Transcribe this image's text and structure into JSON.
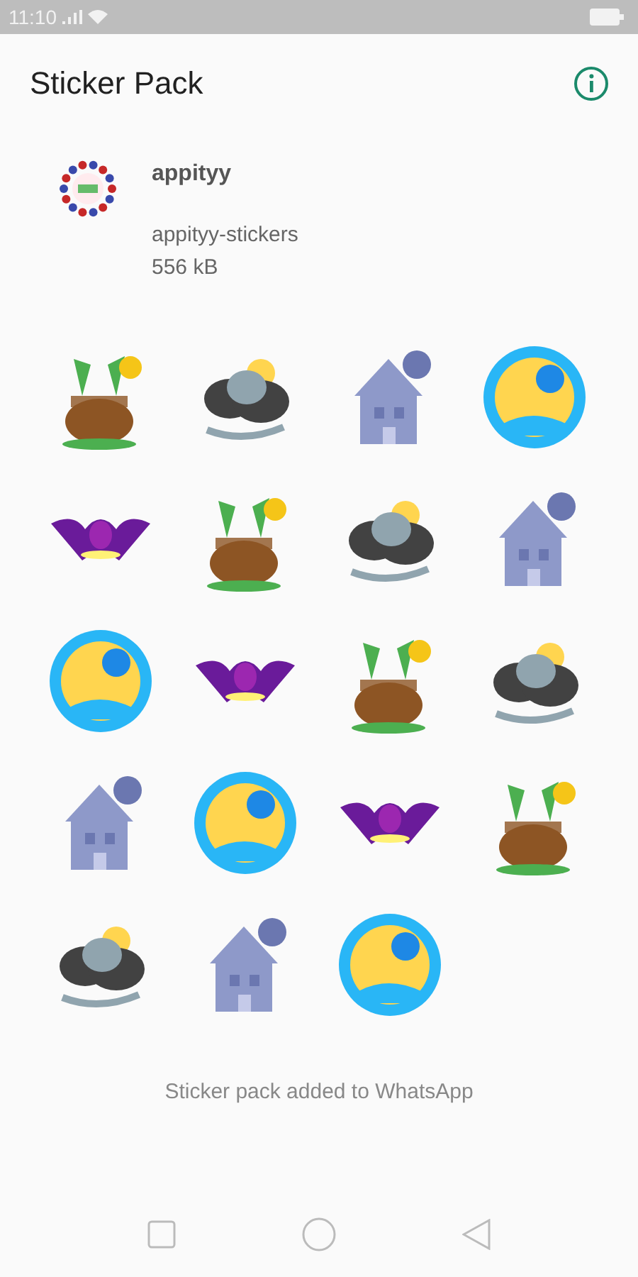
{
  "status_bar": {
    "time": "11:10"
  },
  "toolbar": {
    "title": "Sticker Pack"
  },
  "pack": {
    "name": "appityy",
    "publisher": "appityy-stickers",
    "size": "556 kB"
  },
  "footer": {
    "message": "Sticker pack added to WhatsApp"
  }
}
